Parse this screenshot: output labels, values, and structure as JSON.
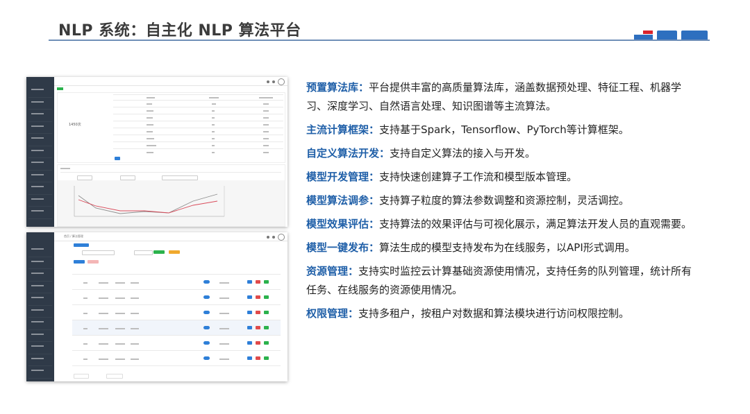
{
  "slide": {
    "title": "NLP 系统：自主化 NLP 算法平台",
    "accent_color": "#2e6fbf",
    "mark_color": "#d9232d"
  },
  "features": [
    {
      "key": "预置算法库：",
      "text": "平台提供丰富的高质量算法库，涵盖数据预处理、特征工程、机器学习、深度学习、自然语言处理、知识图谱等主流算法。"
    },
    {
      "key": "主流计算框架：",
      "text": "支持基于Spark，Tensorflow、PyTorch等计算框架。"
    },
    {
      "key": "自定义算法开发：",
      "text": "支持自定义算法的接入与开发。"
    },
    {
      "key": "模型开发管理：",
      "text": "支持快速创建算子工作流和模型版本管理。"
    },
    {
      "key": "模型算法调参：",
      "text": "支持算子粒度的算法参数调整和资源控制，灵活调控。"
    },
    {
      "key": "模型效果评估：",
      "text": "支持算法的效果评估与可视化展示，满足算法开发人员的直观需要。"
    },
    {
      "key": "模型一键发布：",
      "text": "算法生成的模型支持发布为在线服务，以API形式调用。"
    },
    {
      "key": "资源管理：",
      "text": "支持实时监控云计算基础资源使用情况，支持任务的队列管理，统计所有任务、在线服务的资源使用情况。"
    },
    {
      "key": "权限管理：",
      "text": "支持多租户，按租户对数据和算法模块进行访问权限控制。"
    }
  ],
  "screens": {
    "dashboard": {
      "summary_value": "1450次"
    },
    "list": {
      "toolbar_note": "首页 / 算法管理"
    }
  }
}
